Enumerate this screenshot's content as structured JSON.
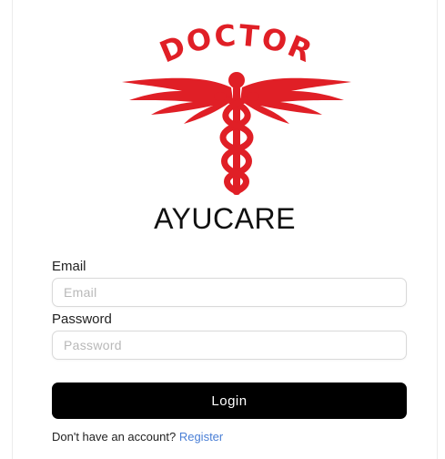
{
  "logo": {
    "arc_text": "DOCTOR",
    "icon": "caduceus-icon",
    "color": "#e01f26"
  },
  "brand": {
    "name": "AYUCARE"
  },
  "form": {
    "email_label": "Email",
    "email_placeholder": "Email",
    "email_value": "",
    "password_label": "Password",
    "password_placeholder": "Password",
    "password_value": "",
    "login_label": "Login"
  },
  "footer": {
    "prompt": "Don't have an account?",
    "register_label": "Register",
    "link_color": "#4a7fd6"
  }
}
